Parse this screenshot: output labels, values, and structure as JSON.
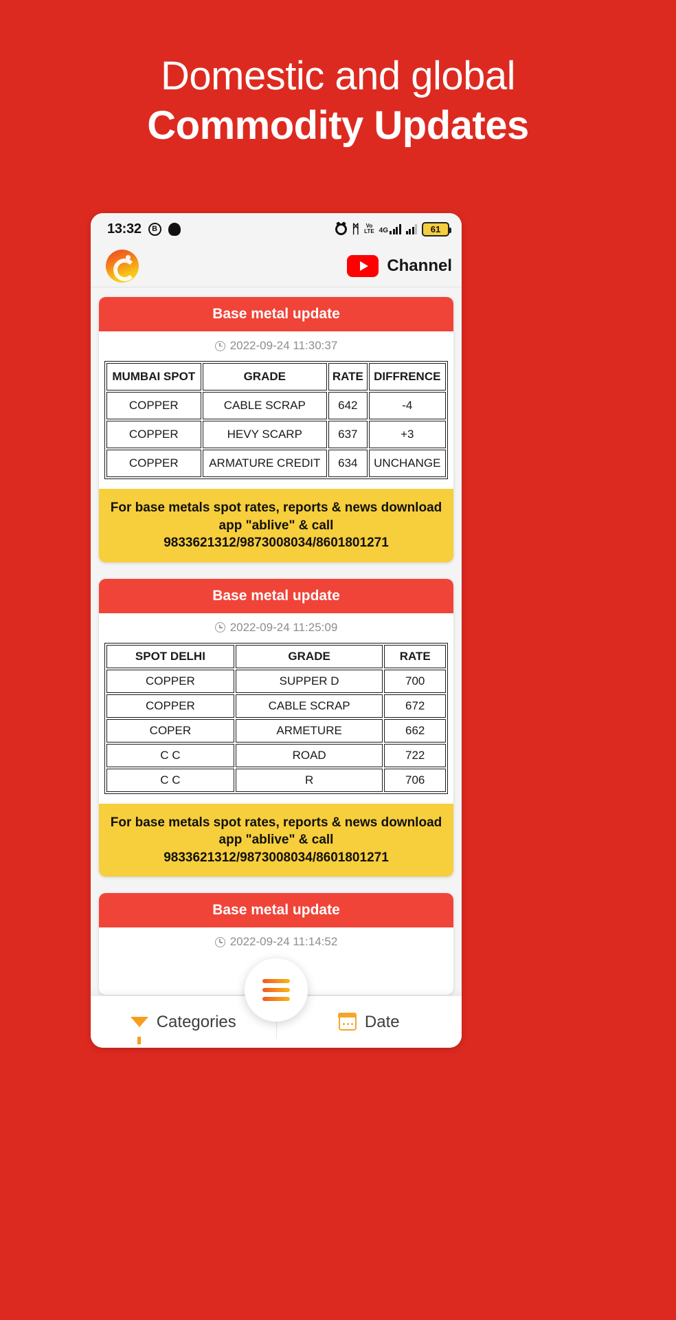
{
  "promo": {
    "line1": "Domestic and global",
    "line2": "Commodity Updates"
  },
  "colors": {
    "background": "#DD2A20",
    "card_header": "#F04438",
    "banner": "#F7CE3C",
    "accent_orange": "#F79D1E"
  },
  "status_bar": {
    "time": "13:32",
    "icons": [
      "bubble-b-icon",
      "snapchat-ghost-icon",
      "alarm-icon",
      "bluetooth-icon",
      "volte-icon",
      "4g-icon",
      "signal-bars-icon",
      "signal-bars-2-icon"
    ],
    "volte_label_top": "Vo",
    "volte_label_bottom": "LTE",
    "network_label": "4G",
    "bluetooth_glyph": "ᛗ",
    "battery_level": "61"
  },
  "app_bar": {
    "logo_name": "ablive-logo",
    "youtube_label": "Channel"
  },
  "cards": [
    {
      "title": "Base metal update",
      "timestamp": "2022-09-24 11:30:37",
      "table": {
        "headers": [
          "MUMBAI SPOT",
          "GRADE",
          "RATE",
          "DIFFRENCE"
        ],
        "rows": [
          [
            "COPPER",
            "CABLE SCRAP",
            "642",
            "-4"
          ],
          [
            "COPPER",
            "HEVY SCARP",
            "637",
            "+3"
          ],
          [
            "COPPER",
            "ARMATURE CREDIT",
            "634",
            "UNCHANGE"
          ]
        ]
      },
      "banner": "For base metals spot rates, reports & news download app \"ablive\" & call 9833621312/9873008034/8601801271"
    },
    {
      "title": "Base metal update",
      "timestamp": "2022-09-24 11:25:09",
      "table": {
        "headers": [
          "SPOT DELHI",
          "GRADE",
          "RATE"
        ],
        "rows": [
          [
            "COPPER",
            "SUPPER D",
            "700"
          ],
          [
            "COPPER",
            "CABLE SCRAP",
            "672"
          ],
          [
            "COPER",
            "ARMETURE",
            "662"
          ],
          [
            "C C",
            "ROAD",
            "722"
          ],
          [
            "C C",
            "R",
            "706"
          ]
        ]
      },
      "banner": "For base metals spot rates, reports & news download app \"ablive\" & call 9833621312/9873008034/8601801271"
    },
    {
      "title": "Base metal update",
      "timestamp": "2022-09-24 11:14:52"
    }
  ],
  "bottom_nav": {
    "categories_label": "Categories",
    "date_label": "Date",
    "fab_name": "menu-fab"
  }
}
